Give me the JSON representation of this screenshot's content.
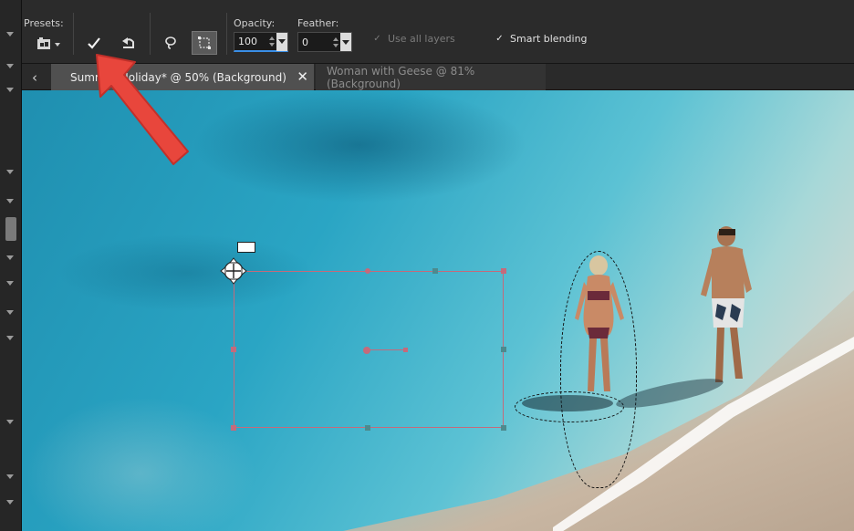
{
  "toolbar": {
    "presets_label": "Presets:",
    "opacity_label": "Opacity:",
    "feather_label": "Feather:",
    "opacity_value": "100",
    "feather_value": "0",
    "use_all_layers_label": "Use all layers",
    "use_all_layers_checked": true,
    "use_all_layers_enabled": false,
    "smart_blending_label": "Smart blending",
    "smart_blending_checked": true
  },
  "tabs": [
    {
      "label": "Summer Holiday* @  50% (Background)",
      "active": true
    },
    {
      "label": "Woman with Geese @  81% (Background)",
      "active": false
    }
  ],
  "colors": {
    "annotation_arrow": "#e8463c",
    "selection_outline": "#c56a7b",
    "opacity_focus": "#3a8ee6"
  }
}
